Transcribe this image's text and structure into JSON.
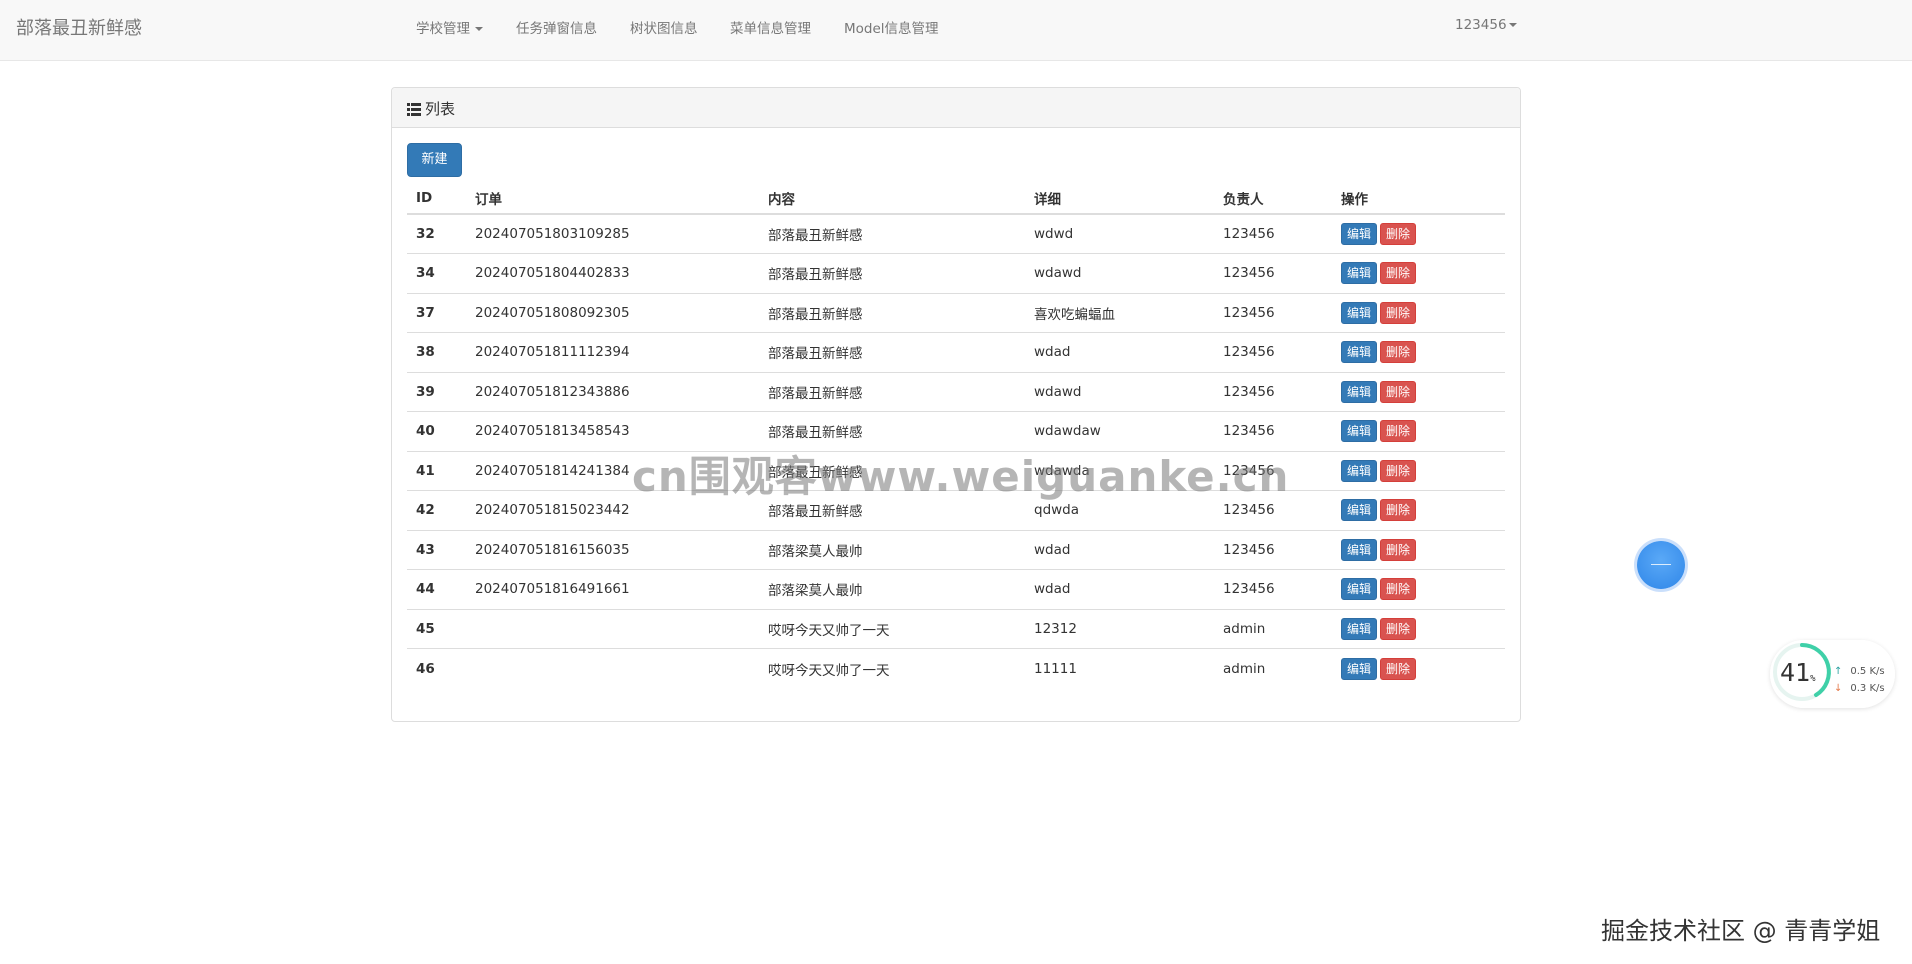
{
  "navbar": {
    "brand": "部落最丑新鲜感",
    "items": [
      {
        "label": "学校管理",
        "dropdown": true
      },
      {
        "label": "任务弹窗信息"
      },
      {
        "label": "树状图信息"
      },
      {
        "label": "菜单信息管理"
      },
      {
        "label": "Model信息管理"
      }
    ],
    "user": "123456"
  },
  "panel": {
    "title": "列表",
    "new_button": "新建",
    "columns": [
      "ID",
      "订单",
      "内容",
      "详细",
      "负责人",
      "操作"
    ],
    "edit_label": "编辑",
    "delete_label": "删除",
    "rows": [
      {
        "id": "32",
        "order": "202407051803109285",
        "content": "部落最丑新鲜感",
        "detail": "wdwd",
        "owner": "123456"
      },
      {
        "id": "34",
        "order": "202407051804402833",
        "content": "部落最丑新鲜感",
        "detail": "wdawd",
        "owner": "123456"
      },
      {
        "id": "37",
        "order": "202407051808092305",
        "content": "部落最丑新鲜感",
        "detail": "喜欢吃蝙蝠血",
        "owner": "123456"
      },
      {
        "id": "38",
        "order": "202407051811112394",
        "content": "部落最丑新鲜感",
        "detail": "wdad",
        "owner": "123456"
      },
      {
        "id": "39",
        "order": "202407051812343886",
        "content": "部落最丑新鲜感",
        "detail": "wdawd",
        "owner": "123456"
      },
      {
        "id": "40",
        "order": "202407051813458543",
        "content": "部落最丑新鲜感",
        "detail": "wdawdaw",
        "owner": "123456"
      },
      {
        "id": "41",
        "order": "202407051814241384",
        "content": "部落最丑新鲜感",
        "detail": "wdawda",
        "owner": "123456"
      },
      {
        "id": "42",
        "order": "202407051815023442",
        "content": "部落最丑新鲜感",
        "detail": "qdwda",
        "owner": "123456"
      },
      {
        "id": "43",
        "order": "202407051816156035",
        "content": "部落梁莫人最帅",
        "detail": "wdad",
        "owner": "123456"
      },
      {
        "id": "44",
        "order": "202407051816491661",
        "content": "部落梁莫人最帅",
        "detail": "wdad",
        "owner": "123456"
      },
      {
        "id": "45",
        "order": "",
        "content": "哎呀今天又帅了一天",
        "detail": "12312",
        "owner": "admin"
      },
      {
        "id": "46",
        "order": "",
        "content": "哎呀今天又帅了一天",
        "detail": "11111",
        "owner": "admin"
      }
    ]
  },
  "watermark": "cn围观客www.weiguanke.cn",
  "speed_widget": {
    "percent": "41",
    "percent_unit": "%",
    "up": "0.5 K/s",
    "down": "0.3 K/s"
  },
  "footer_mark": "掘金技术社区 @ 青青学姐",
  "colors": {
    "primary": "#337ab7",
    "danger": "#d9534f",
    "navbar_bg": "#f8f8f8"
  },
  "icons": {
    "panel": "list-icon",
    "dropdown": "caret-down-icon",
    "floating": "assistive-ball-icon"
  }
}
